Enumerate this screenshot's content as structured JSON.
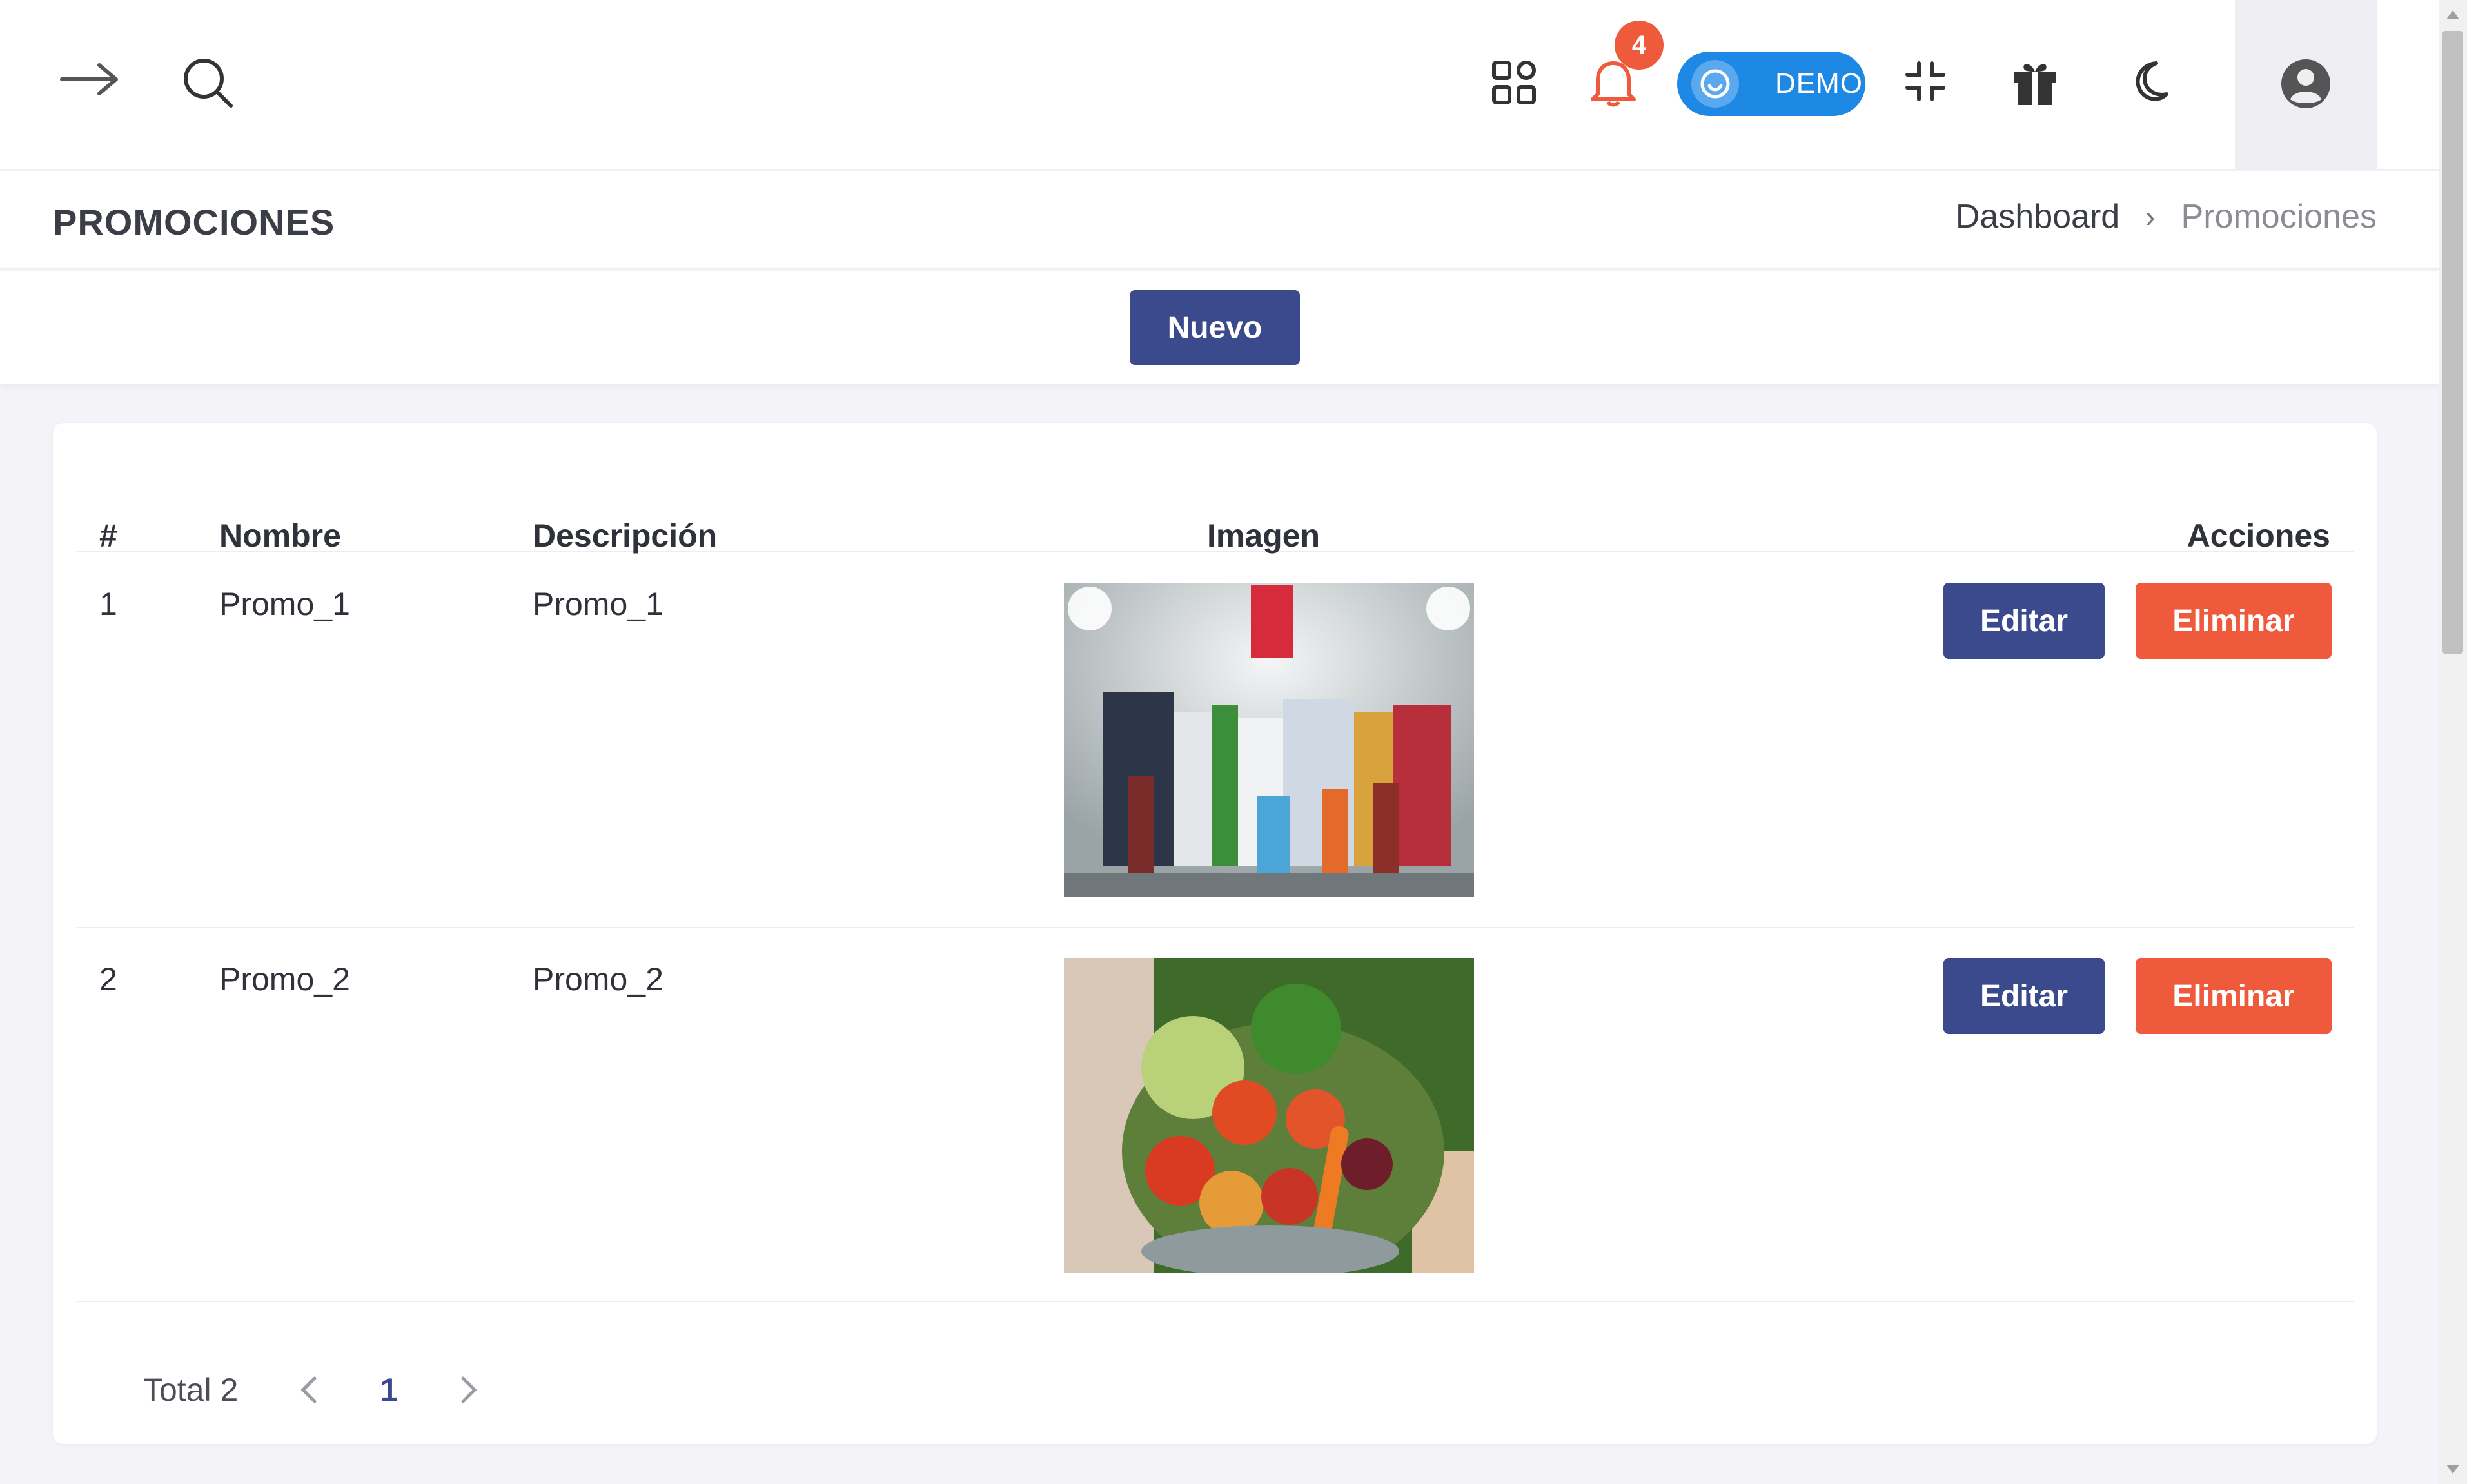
{
  "page": {
    "title": "PROMOCIONES",
    "breadcrumb": {
      "home": "Dashboard",
      "separator": "›",
      "current": "Promociones"
    }
  },
  "topbar": {
    "icons": [
      "arrow-right-icon",
      "search-icon",
      "apps-grid-icon",
      "bell-icon",
      "compress-icon",
      "gift-icon",
      "moon-icon",
      "user-circle-icon"
    ],
    "notifications_count": "4",
    "demo_label": "DEMO"
  },
  "toolbar": {
    "new_label": "Nuevo"
  },
  "table": {
    "columns": [
      "#",
      "Nombre",
      "Descripción",
      "Imagen",
      "Acciones"
    ],
    "rows": [
      {
        "id": "1",
        "nombre": "Promo_1",
        "descripcion": "Promo_1",
        "image": "products-showcase"
      },
      {
        "id": "2",
        "nombre": "Promo_2",
        "descripcion": "Promo_2",
        "image": "vegetable-basket"
      }
    ],
    "edit_label": "Editar",
    "delete_label": "Eliminar"
  },
  "pagination": {
    "total_label": "Total 2",
    "current_page": "1"
  },
  "colors": {
    "primary": "#3a4a8c",
    "danger": "#ef5a3c",
    "demo": "#1e88e5",
    "badge": "#ef5a3c"
  }
}
